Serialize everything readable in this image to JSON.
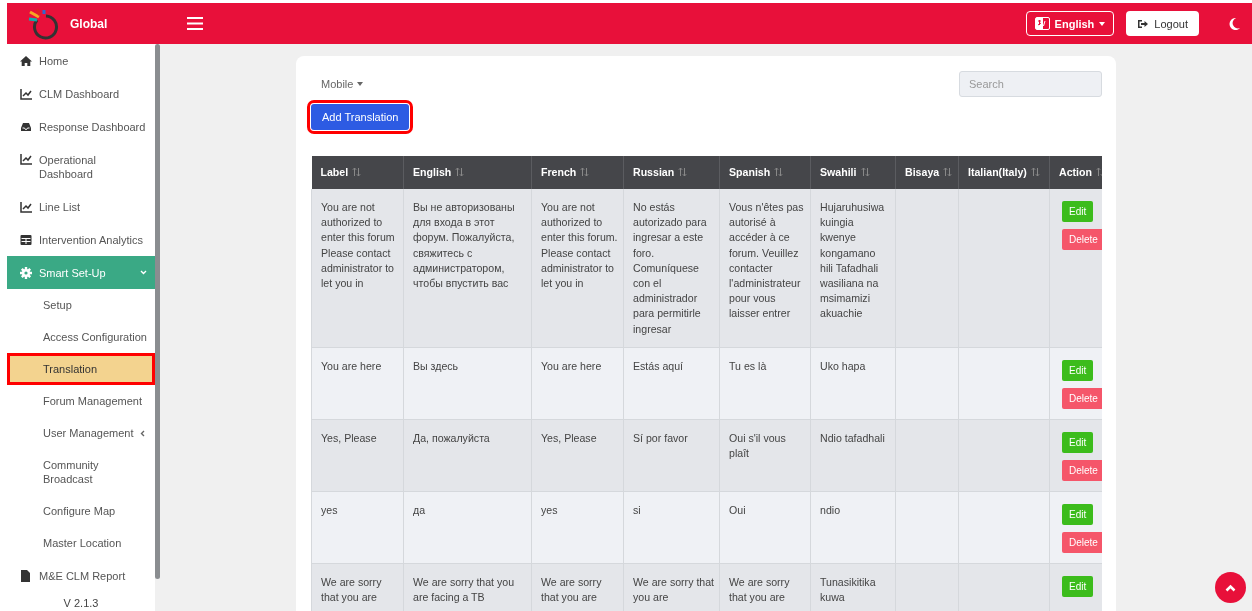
{
  "topbar": {
    "brand": "Global",
    "language": {
      "label": "English"
    },
    "logout": {
      "label": "Logout"
    }
  },
  "sidebar": {
    "items": [
      {
        "label": "Home",
        "selected": false
      },
      {
        "label": "CLM Dashboard",
        "selected": false
      },
      {
        "label": "Response Dashboard",
        "selected": false
      },
      {
        "label": "Operational Dashboard",
        "selected": false
      },
      {
        "label": "Line List",
        "selected": false
      },
      {
        "label": "Intervention Analytics",
        "selected": false
      },
      {
        "label": "Smart Set-Up",
        "selected": true,
        "expanded": true,
        "children": [
          {
            "label": "Setup",
            "selected": false,
            "highlighted": false
          },
          {
            "label": "Access Configuration",
            "selected": false,
            "highlighted": false
          },
          {
            "label": "Translation",
            "selected": true,
            "highlighted": true
          },
          {
            "label": "Forum Management",
            "selected": false,
            "highlighted": false
          },
          {
            "label": "User Management",
            "selected": false,
            "highlighted": false,
            "expanded": false
          },
          {
            "label": "Community Broadcast",
            "selected": false,
            "highlighted": false
          },
          {
            "label": "Configure Map",
            "selected": false,
            "highlighted": false
          },
          {
            "label": "Master Location",
            "selected": false,
            "highlighted": false
          }
        ]
      },
      {
        "label": "M&E CLM Report",
        "selected": false
      }
    ],
    "version": "V 2.1.3"
  },
  "card": {
    "filter": {
      "label": "Mobile"
    },
    "search": {
      "placeholder": "Search"
    },
    "add_button": {
      "label": "Add Translation",
      "highlighted": true
    },
    "table": {
      "columns": [
        "Label",
        "English",
        "French",
        "Russian",
        "Spanish",
        "Swahili",
        "Bisaya",
        "Italian(Italy)",
        "Action"
      ],
      "rows": [
        {
          "cells": [
            "You are not authorized to enter this forum Please contact administrator to let you in",
            "Вы не авторизованы для входа в этот форум. Пожалуйста, свяжитесь с администратором, чтобы впустить вас",
            "You are not authorized to enter this forum. Please contact administrator to let you in",
            "No estás autorizado para ingresar a este foro. Comuníquese con el administrador para permitirle ingresar",
            "Vous n'êtes pas autorisé à accéder à ce forum. Veuillez contacter l'administrateur pour vous laisser entrer",
            "Hujaruhusiwa kuingia kwenye kongamano hili Tafadhali wasiliana na msimamizi akuachie",
            "",
            ""
          ],
          "actions": [
            {
              "label": "Edit",
              "kind": "edit"
            },
            {
              "label": "Delete",
              "kind": "delete"
            }
          ]
        },
        {
          "cells": [
            "You are here",
            "Вы здесь",
            "You are here",
            "Estás aquí",
            "Tu es là",
            "Uko hapa",
            "",
            ""
          ],
          "actions": [
            {
              "label": "Edit",
              "kind": "edit"
            },
            {
              "label": "Delete",
              "kind": "delete"
            }
          ]
        },
        {
          "cells": [
            "Yes, Please",
            "Да, пожалуйста",
            "Yes, Please",
            "Sí por favor",
            "Oui s'il vous plaît",
            "Ndio tafadhali",
            "",
            ""
          ],
          "actions": [
            {
              "label": "Edit",
              "kind": "edit"
            },
            {
              "label": "Delete",
              "kind": "delete"
            }
          ]
        },
        {
          "cells": [
            "yes",
            "да",
            "yes",
            "si",
            "Oui",
            "ndio",
            "",
            ""
          ],
          "actions": [
            {
              "label": "Edit",
              "kind": "edit"
            },
            {
              "label": "Delete",
              "kind": "delete"
            }
          ]
        },
        {
          "cells": [
            "We are sorry that you are",
            "We are sorry that you are facing a TB",
            "We are sorry that you are",
            "We are sorry that you are",
            "We are sorry that you are",
            "Tunasikitika kuwa",
            "",
            ""
          ],
          "actions": [
            {
              "label": "Edit",
              "kind": "edit"
            }
          ]
        }
      ]
    }
  }
}
